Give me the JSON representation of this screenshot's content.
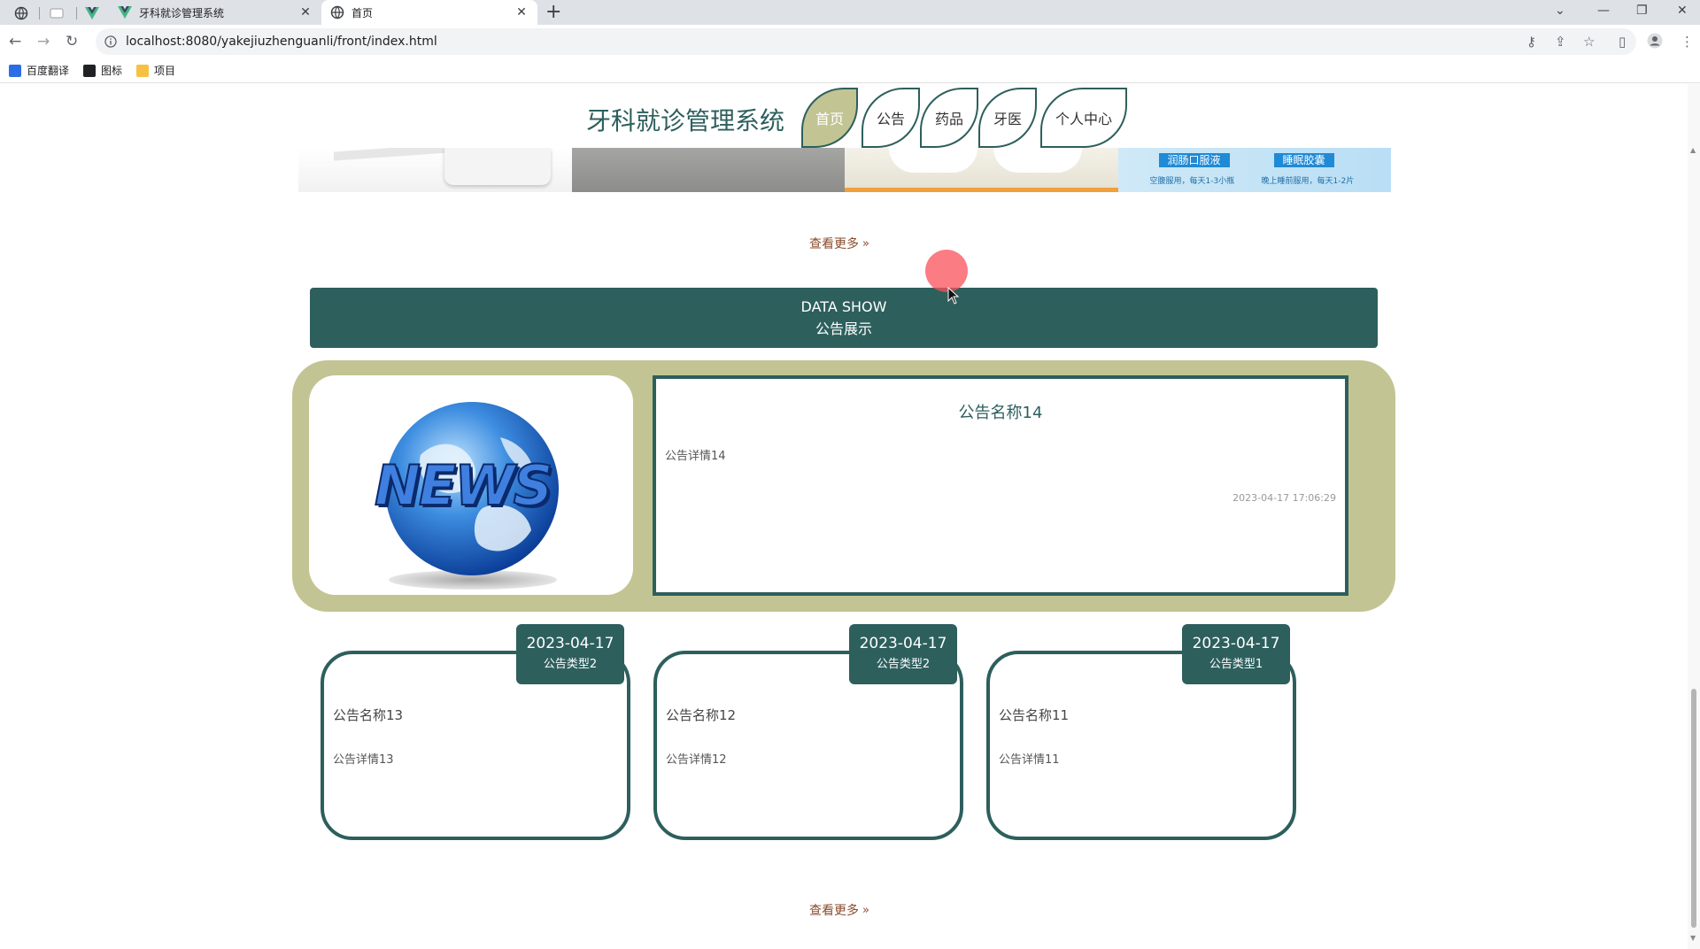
{
  "browser": {
    "tabs": [
      {
        "title": "牙科就诊管理系统",
        "active": false
      },
      {
        "title": "首页",
        "active": true
      }
    ],
    "url": "localhost:8080/yakejiuzhenguanli/front/index.html",
    "bookmarks": [
      "百度翻译",
      "图标",
      "项目"
    ]
  },
  "site": {
    "title": "牙科就诊管理系统",
    "nav": [
      {
        "label": "首页",
        "active": true
      },
      {
        "label": "公告",
        "active": false
      },
      {
        "label": "药品",
        "active": false
      },
      {
        "label": "牙医",
        "active": false
      },
      {
        "label": "个人中心",
        "active": false
      }
    ]
  },
  "banner": {
    "labels": [
      "润肠口服液",
      "睡眠胶囊"
    ],
    "sublabels": [
      "空腹服用，每天1-3小瓶",
      "晚上睡前服用，每天1-2片"
    ]
  },
  "more_label": "查看更多",
  "data_show": {
    "en": "DATA SHOW",
    "zh": "公告展示"
  },
  "featured": {
    "image_text": "NEWS",
    "title": "公告名称14",
    "detail": "公告详情14",
    "datetime": "2023-04-17 17:06:29"
  },
  "notices": [
    {
      "date": "2023-04-17",
      "type": "公告类型2",
      "title": "公告名称13",
      "detail": "公告详情13"
    },
    {
      "date": "2023-04-17",
      "type": "公告类型2",
      "title": "公告名称12",
      "detail": "公告详情12"
    },
    {
      "date": "2023-04-17",
      "type": "公告类型1",
      "title": "公告名称11",
      "detail": "公告详情11"
    }
  ],
  "colors": {
    "primary": "#2d5f5d",
    "accent": "#c3c493",
    "link": "#8a4b2c"
  }
}
